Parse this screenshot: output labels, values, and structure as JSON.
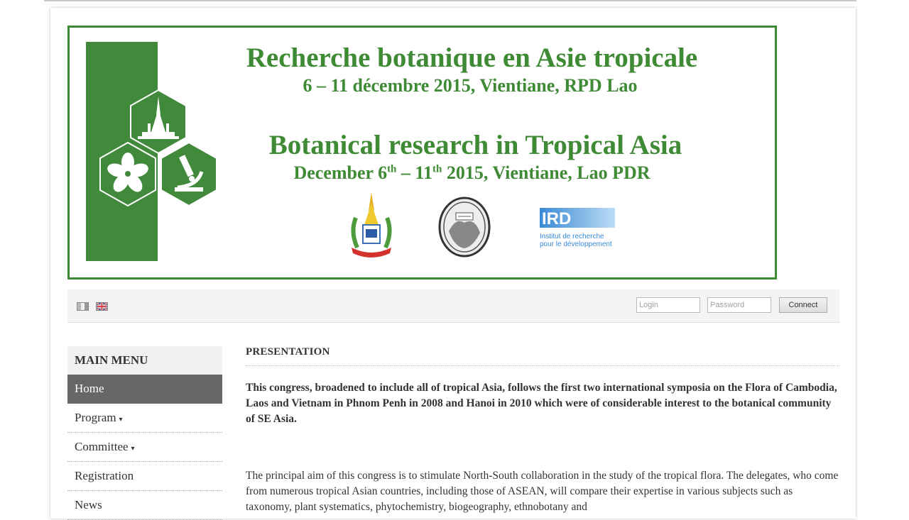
{
  "banner": {
    "title_fr": "Recherche botanique en Asie tropicale",
    "dates_fr": "6 – 11 décembre 2015, Vientiane, RPD Lao",
    "title_en": "Botanical research in Tropical Asia",
    "dates_en_a": "December 6",
    "dates_en_sup1": "th",
    "dates_en_b": " – 11",
    "dates_en_sup2": "th",
    "dates_en_c": " 2015, Vientiane, Lao PDR",
    "ird_acronym": "IRD",
    "ird_line1": "Institut de recherche",
    "ird_line2": "pour le développement"
  },
  "toolbar": {
    "login_placeholder": "Login",
    "password_placeholder": "Password",
    "connect_label": "Connect"
  },
  "menu": {
    "title": "MAIN MENU",
    "items": [
      {
        "label": "Home"
      },
      {
        "label": "Program"
      },
      {
        "label": "Committee"
      },
      {
        "label": "Registration"
      },
      {
        "label": "News"
      }
    ],
    "submenu_caret": "▾"
  },
  "content": {
    "heading": "PRESENTATION",
    "intro": "This congress, broadened to include all of tropical Asia, follows the first two international symposia on the Flora of Cambodia, Laos and Vietnam in Phnom Penh in 2008 and Hanoi in 2010 which were of considerable interest to the botanical community of SE Asia.",
    "body": "The principal aim of this congress is to stimulate North-South collaboration in the study of the tropical flora. The delegates, who come from numerous tropical Asian countries, including those of ASEAN, will compare their expertise in various subjects such as taxonomy, plant systematics, phytochemistry, biogeography, ethnobotany and"
  },
  "colors": {
    "banner_green": "#3f8a34",
    "menu_active_bg": "#666666"
  },
  "icons": [
    "french-flag-icon",
    "english-flag-icon",
    "pagoda-icon",
    "flower-icon",
    "microscope-icon"
  ]
}
